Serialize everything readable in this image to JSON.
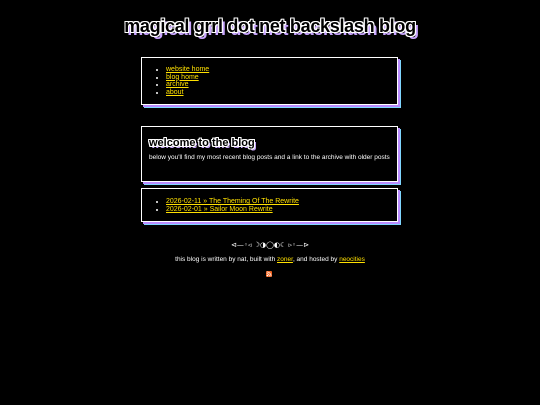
{
  "header": {
    "title": "magical grrl dot net backslash blog"
  },
  "nav": {
    "items": [
      {
        "label": "website home"
      },
      {
        "label": "blog home"
      },
      {
        "label": "archive"
      },
      {
        "label": "about"
      }
    ]
  },
  "welcome": {
    "heading": "welcome to the blog",
    "text": "below you'll find my most recent blog posts and a link to the archive with older posts"
  },
  "posts": {
    "items": [
      {
        "label": "2026-02-11 » The Theming Of The Rewrite"
      },
      {
        "label": "2026-02-01 » Sailor Moon Rewrite"
      }
    ]
  },
  "divider": {
    "text": "⊲—◦◃ ☽◑◯◐☾ ▹◦—⊳"
  },
  "footer": {
    "text_before": "this blog is written by nat, built with ",
    "zoner_link": "zoner",
    "text_middle": ", and hosted by ",
    "neocities_link": "neocities"
  },
  "icons": {
    "feed": "rss-icon"
  },
  "colors": {
    "background": "#000000",
    "link": "#ffe000",
    "shadow_purple": "#b98cff",
    "shadow_cyan": "#7fd6ff",
    "rss_orange": "#f26522"
  }
}
